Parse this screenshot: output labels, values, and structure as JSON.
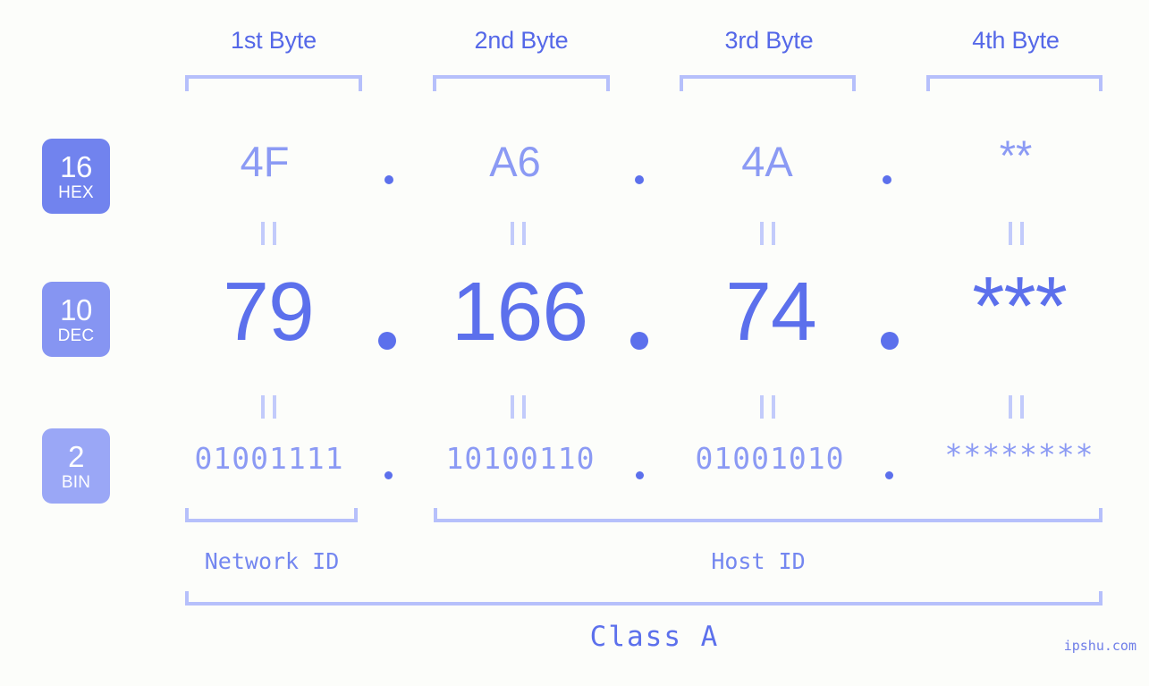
{
  "background_color": "#fcfdfa",
  "accent_color": "#5c70ec",
  "light_accent_color": "#8b9af4",
  "bracket_color": "#b6c0fb",
  "byte_headers": [
    {
      "label": "1st Byte"
    },
    {
      "label": "2nd Byte"
    },
    {
      "label": "3rd Byte"
    },
    {
      "label": "4th Byte"
    }
  ],
  "bases": [
    {
      "number": "16",
      "name": "HEX",
      "color": "#7183ee"
    },
    {
      "number": "10",
      "name": "DEC",
      "color": "#8695f2"
    },
    {
      "number": "2",
      "name": "BIN",
      "color": "#9aa7f6"
    }
  ],
  "rows": {
    "hex": {
      "values": [
        "4F",
        "A6",
        "4A",
        "**"
      ],
      "separator": "."
    },
    "dec": {
      "values": [
        "79",
        "166",
        "74",
        "***"
      ],
      "separator": "."
    },
    "bin": {
      "values": [
        "01001111",
        "10100110",
        "01001010",
        "********"
      ],
      "separator": "."
    }
  },
  "equality_marks": {
    "symbol": "||",
    "count_per_row": 4,
    "rows": 2
  },
  "sections": [
    {
      "label": "Network ID",
      "spans_bytes": [
        1
      ]
    },
    {
      "label": "Host ID",
      "spans_bytes": [
        2,
        3,
        4
      ]
    }
  ],
  "class": {
    "label": "Class A"
  },
  "watermark": {
    "text": "ipshu.com"
  }
}
